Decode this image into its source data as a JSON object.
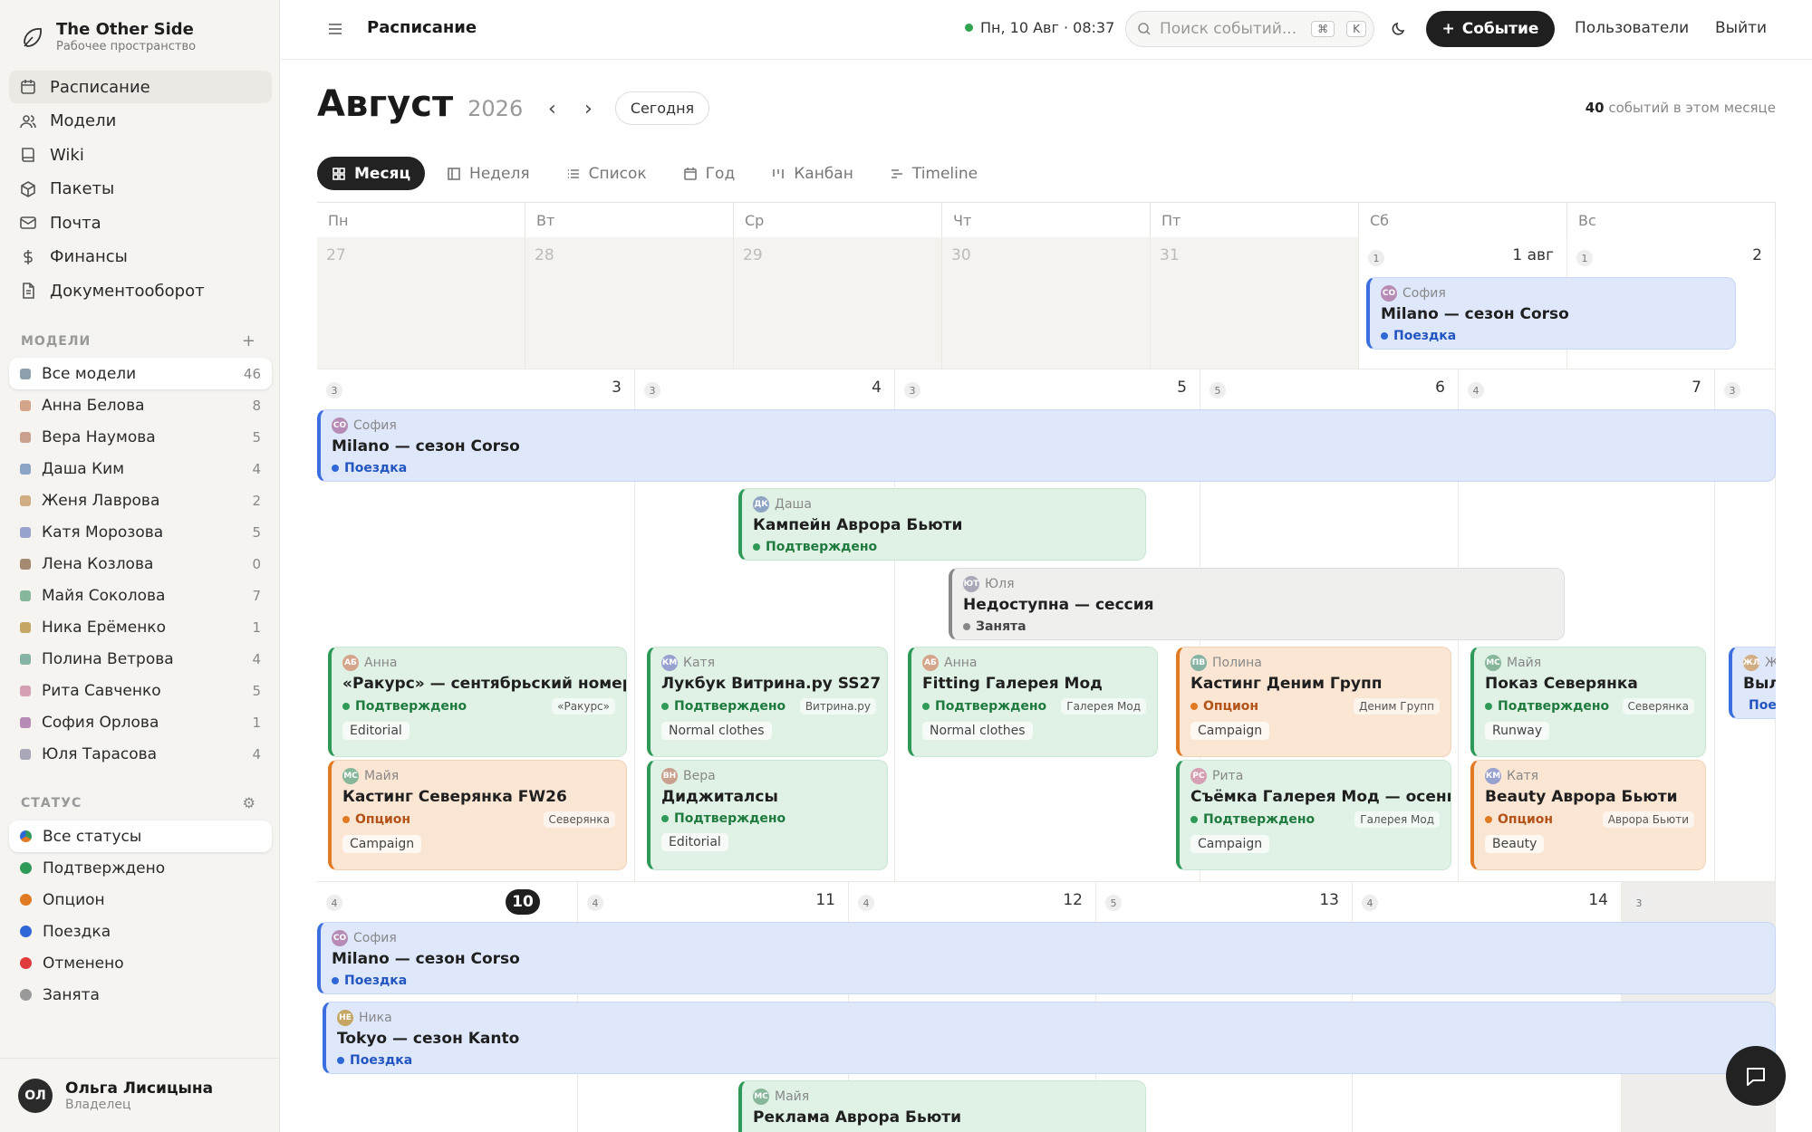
{
  "app": {
    "name": "The Other Side",
    "workspace": "Рабочее пространство"
  },
  "nav": [
    {
      "label": "Расписание",
      "icon": "calendar-icon"
    },
    {
      "label": "Модели",
      "icon": "users-icon"
    },
    {
      "label": "Wiki",
      "icon": "book-icon"
    },
    {
      "label": "Пакеты",
      "icon": "package-icon"
    },
    {
      "label": "Почта",
      "icon": "mail-icon"
    },
    {
      "label": "Финансы",
      "icon": "dollar-icon"
    },
    {
      "label": "Документооборот",
      "icon": "document-icon"
    }
  ],
  "models_section": {
    "title": "МОДЕЛИ",
    "add": "+",
    "items": [
      {
        "label": "Все модели",
        "count": "46",
        "color": "#8fa0ad"
      },
      {
        "label": "Анна Белова",
        "count": "8",
        "color": "#d4a58a"
      },
      {
        "label": "Вера Наумова",
        "count": "5",
        "color": "#c9a08e"
      },
      {
        "label": "Даша Ким",
        "count": "4",
        "color": "#8ea4c4"
      },
      {
        "label": "Женя Лаврова",
        "count": "2",
        "color": "#d1ad84"
      },
      {
        "label": "Катя Морозова",
        "count": "5",
        "color": "#98a2cf"
      },
      {
        "label": "Лена Козлова",
        "count": "0",
        "color": "#a58a72"
      },
      {
        "label": "Майя Соколова",
        "count": "7",
        "color": "#86b79a"
      },
      {
        "label": "Ника Ерёменко",
        "count": "1",
        "color": "#c4a765"
      },
      {
        "label": "Полина Ветрова",
        "count": "4",
        "color": "#86b3a4"
      },
      {
        "label": "Рита Савченко",
        "count": "5",
        "color": "#d6a0b4"
      },
      {
        "label": "София Орлова",
        "count": "1",
        "color": "#b68bb5"
      },
      {
        "label": "Юля Тарасова",
        "count": "4",
        "color": "#a8a8b8"
      }
    ]
  },
  "status_section": {
    "title": "СТАТУС",
    "items": [
      {
        "label": "Все статусы",
        "color": "#e07a23"
      },
      {
        "label": "Подтверждено",
        "color": "#2f9a57"
      },
      {
        "label": "Опцион",
        "color": "#e07a23"
      },
      {
        "label": "Поездка",
        "color": "#2f66d8"
      },
      {
        "label": "Отменено",
        "color": "#e03b3b"
      },
      {
        "label": "Занята",
        "color": "#999999"
      }
    ]
  },
  "user": {
    "initials": "ОЛ",
    "name": "Ольга Лисицына",
    "role": "Владелец"
  },
  "topbar": {
    "title": "Расписание",
    "clock": "Пн, 10 Авг · 08:37",
    "search_placeholder": "Поиск событий...",
    "kbd1": "⌘",
    "kbd2": "K",
    "new_event": "Событие",
    "users": "Пользователи",
    "logout": "Выйти"
  },
  "month": {
    "name": "Август",
    "year": "2026",
    "today": "Сегодня",
    "count": "40",
    "count_label": "событий в этом месяце"
  },
  "views": [
    "Месяц",
    "Неделя",
    "Список",
    "Год",
    "Канбан",
    "Timeline"
  ],
  "weekdays": [
    "Пн",
    "Вт",
    "Ср",
    "Чт",
    "Пт",
    "Сб",
    "Вс"
  ],
  "weeks": [
    {
      "days": [
        {
          "n": "27"
        },
        {
          "n": "28"
        },
        {
          "n": "29"
        },
        {
          "n": "30"
        },
        {
          "n": "31"
        },
        {
          "n": "1 авг",
          "c": "1"
        },
        {
          "n": "2",
          "c": "1"
        }
      ]
    },
    {
      "days": [
        {
          "n": "3",
          "c": "3"
        },
        {
          "n": "4",
          "c": "3"
        },
        {
          "n": "5",
          "c": "3"
        },
        {
          "n": "6",
          "c": "5"
        },
        {
          "n": "7",
          "c": "4"
        },
        {
          "n": "",
          "c": "3"
        }
      ]
    },
    {
      "days": [
        {
          "n": "10",
          "c": "4"
        },
        {
          "n": "11",
          "c": "4"
        },
        {
          "n": "12",
          "c": "4"
        },
        {
          "n": "13",
          "c": "5"
        },
        {
          "n": "14",
          "c": "4"
        },
        {
          "n": "",
          "c": "3"
        }
      ]
    }
  ],
  "events": [
    {
      "who": "София",
      "ini": "СО",
      "avc": "#b68bb5",
      "title": "Milano — сезон Corso",
      "status": "Поездка",
      "kind": "trip"
    },
    {
      "who": "София",
      "ini": "СО",
      "avc": "#b68bb5",
      "title": "Milano — сезон Corso",
      "status": "Поездка",
      "kind": "trip"
    },
    {
      "who": "Даша",
      "ini": "ДК",
      "avc": "#8ea4c4",
      "title": "Кампейн Аврора Бьюти",
      "status": "Подтверждено",
      "kind": "conf"
    },
    {
      "who": "Юля",
      "ini": "ЮТ",
      "avc": "#a8a8b8",
      "title": "Недоступна — сессия",
      "status": "Занята",
      "kind": "busy"
    },
    {
      "who": "Анна",
      "ini": "АБ",
      "avc": "#d4a58a",
      "title": "«Ракурс» — сентябрьский номер",
      "status": "Подтверждено",
      "client": "«Ракурс»",
      "tag": "Editorial",
      "kind": "conf"
    },
    {
      "who": "Катя",
      "ini": "КМ",
      "avc": "#98a2cf",
      "title": "Лукбук Витрина.ру SS27",
      "status": "Подтверждено",
      "client": "Витрина.ру",
      "tag": "Normal clothes",
      "kind": "conf"
    },
    {
      "who": "Анна",
      "ini": "АБ",
      "avc": "#d4a58a",
      "title": "Fitting Галерея Мод",
      "status": "Подтверждено",
      "client": "Галерея Мод",
      "tag": "Normal clothes",
      "kind": "conf"
    },
    {
      "who": "Полина",
      "ini": "ПВ",
      "avc": "#86b3a4",
      "title": "Кастинг Деним Групп",
      "status": "Опцион",
      "client": "Деним Групп",
      "tag": "Campaign",
      "kind": "opt"
    },
    {
      "who": "Майя",
      "ini": "МС",
      "avc": "#86b79a",
      "title": "Показ Северянка",
      "status": "Подтверждено",
      "client": "Северянка",
      "tag": "Runway",
      "kind": "conf"
    },
    {
      "who": "Женя",
      "ini": "ЖЛ",
      "avc": "#d1ad84",
      "title": "Вылет — Токио",
      "status": "Поездка",
      "kind": "trip"
    },
    {
      "who": "Майя",
      "ini": "МС",
      "avc": "#86b79a",
      "title": "Кастинг Северянка FW26",
      "status": "Опцион",
      "client": "Северянка",
      "tag": "Campaign",
      "kind": "opt"
    },
    {
      "who": "Вера",
      "ini": "ВН",
      "avc": "#c9a08e",
      "title": "Диджиталсы",
      "status": "Подтверждено",
      "tag": "Editorial",
      "kind": "conf"
    },
    {
      "who": "Рита",
      "ini": "РС",
      "avc": "#d6a0b4",
      "title": "Съёмка Галерея Мод — осень",
      "status": "Подтверждено",
      "client": "Галерея Мод",
      "tag": "Campaign",
      "kind": "conf"
    },
    {
      "who": "Катя",
      "ini": "КМ",
      "avc": "#98a2cf",
      "title": "Beauty Аврора Бьюти",
      "status": "Опцион",
      "client": "Аврора Бьюти",
      "tag": "Beauty",
      "kind": "opt"
    },
    {
      "who": "София",
      "ini": "СО",
      "avc": "#b68bb5",
      "title": "Milano — сезон Corso",
      "status": "Поездка",
      "kind": "trip"
    },
    {
      "who": "Ника",
      "ini": "НЕ",
      "avc": "#c4a765",
      "title": "Tokyo — сезон Kanto",
      "status": "Поездка",
      "kind": "trip"
    },
    {
      "who": "Майя",
      "ini": "МС",
      "avc": "#86b79a",
      "title": "Реклама Аврора Бьюти",
      "status": "Подтверждено",
      "kind": "conf"
    }
  ]
}
